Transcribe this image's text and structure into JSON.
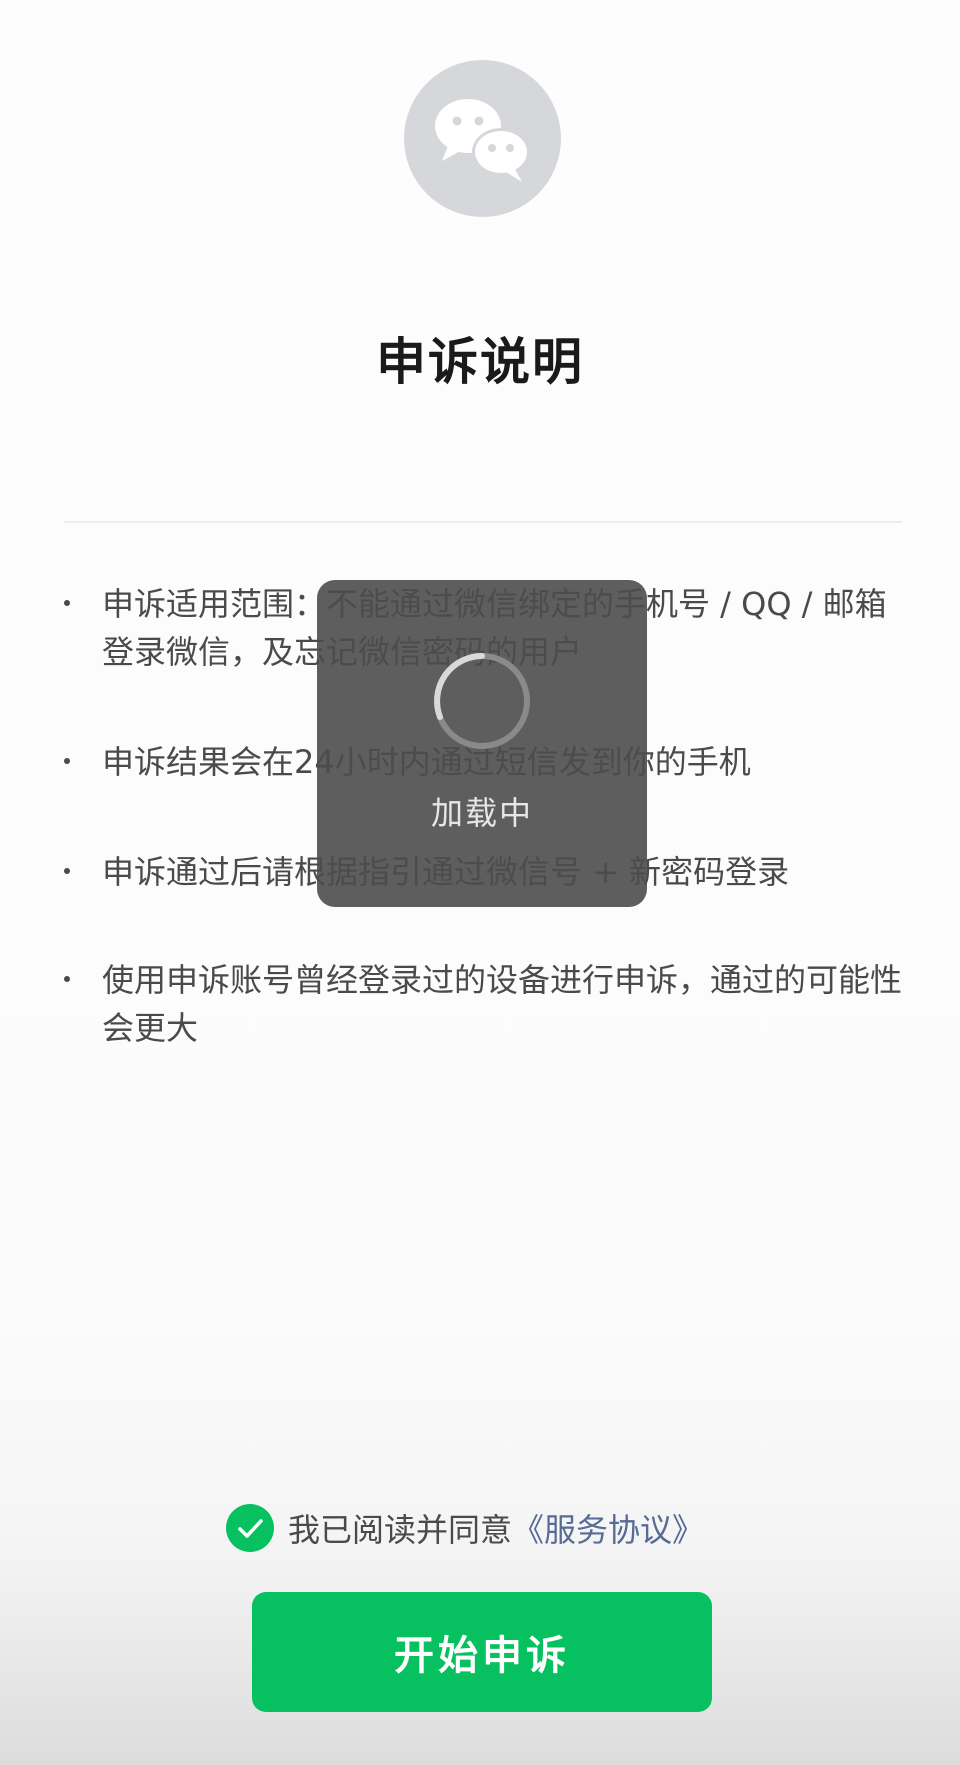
{
  "header": {
    "title": "申诉说明"
  },
  "items": [
    {
      "text": "申诉适用范围：不能通过微信绑定的手机号 / QQ / 邮箱登录微信，及忘记微信密码的用户"
    },
    {
      "text": "申诉结果会在24小时内通过短信发到你的手机"
    },
    {
      "text": "申诉通过后请根据指引通过微信号 + 新密码登录"
    },
    {
      "text": "使用申诉账号曾经登录过的设备进行申诉，通过的可能性会更大"
    }
  ],
  "toast": {
    "text": "加载中"
  },
  "agreement": {
    "text": "我已阅读并同意",
    "link": "《服务协议》",
    "checked": true
  },
  "footer": {
    "button_label": "开始申诉"
  },
  "colors": {
    "accent": "#07c160",
    "link": "#576b95",
    "logo_bg": "#d6d7da"
  },
  "icons": {
    "logo": "wechat-logo-icon",
    "check": "check-circle-icon",
    "spinner": "loading-spinner-icon"
  }
}
